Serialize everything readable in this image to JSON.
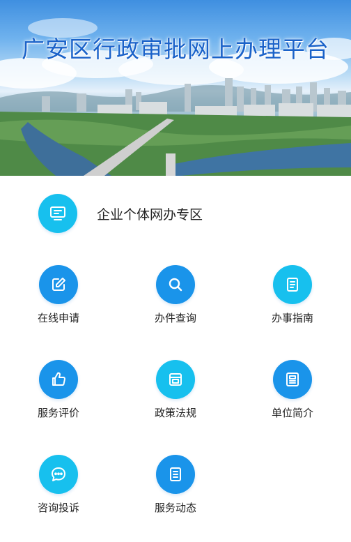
{
  "banner": {
    "title": "广安区行政审批网上办理平台"
  },
  "zone": {
    "label": "企业个体网办专区",
    "icon": "monitor-icon"
  },
  "services": [
    {
      "label": "在线申请",
      "icon": "edit-icon",
      "color": "#1a94ea"
    },
    {
      "label": "办件查询",
      "icon": "search-icon",
      "color": "#1a94ea"
    },
    {
      "label": "办事指南",
      "icon": "guide-book-icon",
      "color": "#17c0ee"
    },
    {
      "label": "服务评价",
      "icon": "thumbs-up-icon",
      "color": "#1a94ea"
    },
    {
      "label": "政策法规",
      "icon": "policy-icon",
      "color": "#17c0ee"
    },
    {
      "label": "单位简介",
      "icon": "profile-card-icon",
      "color": "#1a94ea"
    },
    {
      "label": "咨询投诉",
      "icon": "chat-bubble-icon",
      "color": "#17c0ee"
    },
    {
      "label": "服务动态",
      "icon": "news-doc-icon",
      "color": "#1a94ea"
    }
  ]
}
